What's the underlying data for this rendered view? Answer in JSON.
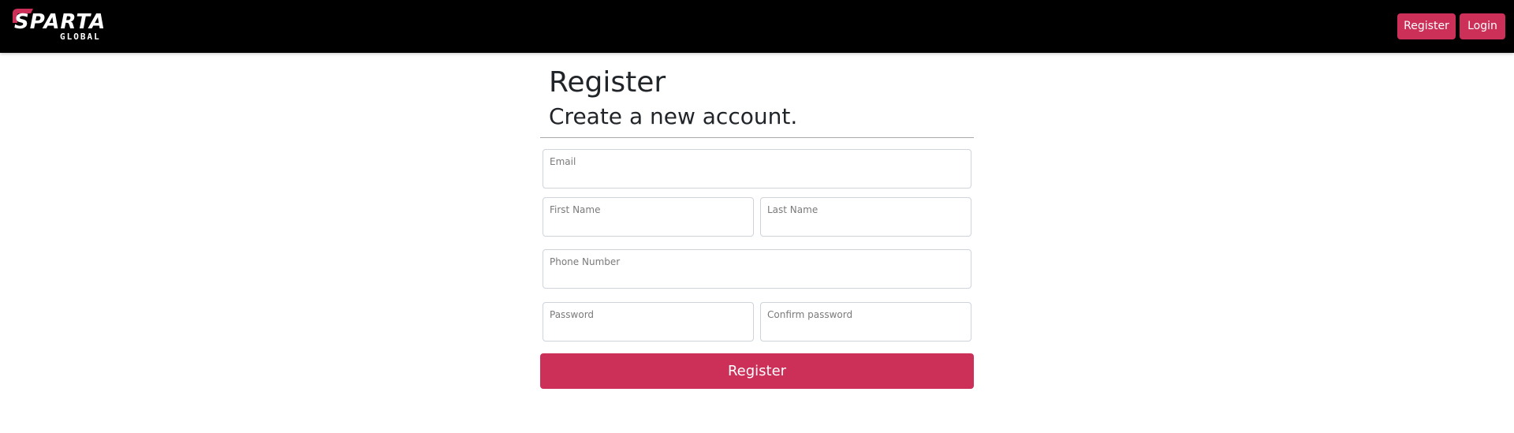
{
  "brand": {
    "name": "SPARTA",
    "tagline": "GLOBAL",
    "accent_color": "#cc2f58"
  },
  "nav": {
    "register_label": "Register",
    "login_label": "Login"
  },
  "page": {
    "title": "Register",
    "subtitle": "Create a new account."
  },
  "form": {
    "email_label": "Email",
    "email_value": "",
    "first_name_label": "First Name",
    "first_name_value": "",
    "last_name_label": "Last Name",
    "last_name_value": "",
    "phone_label": "Phone Number",
    "phone_value": "",
    "password_label": "Password",
    "password_value": "",
    "confirm_password_label": "Confirm password",
    "confirm_password_value": "",
    "submit_label": "Register"
  },
  "colors": {
    "navbar_bg": "#000000",
    "button_bg": "#cc2f58",
    "button_text": "#ffffff"
  }
}
